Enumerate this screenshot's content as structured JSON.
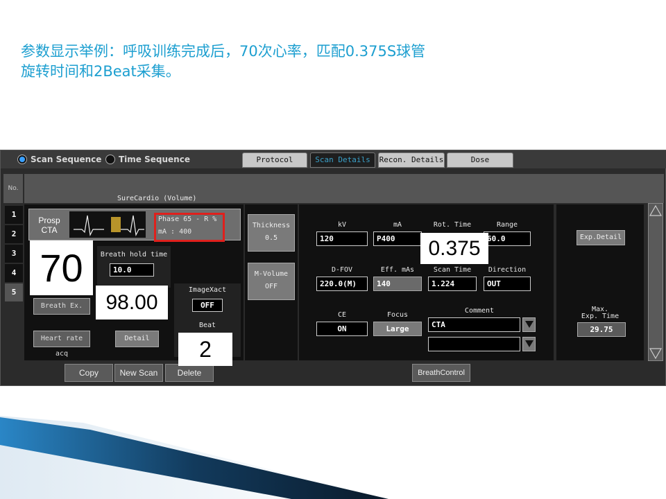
{
  "slide": {
    "title_line1": "参数显示举例：呼吸训练完成后，70次心率，匹配0.375S球管",
    "title_line2": "旋转时间和2Beat采集。"
  },
  "topbar": {
    "radio_scan_sequence": "Scan Sequence",
    "radio_time_sequence": "Time Sequence",
    "selected": "Scan Sequence",
    "tabs": [
      {
        "label": "Protocol"
      },
      {
        "label": "Scan Details"
      },
      {
        "label": "Recon. Details"
      },
      {
        "label": "Dose"
      }
    ],
    "active_tab": "Scan Details"
  },
  "sidebar": {
    "header": "No.",
    "rows": [
      "1",
      "2",
      "3",
      "4",
      "5"
    ],
    "selected_row": "5"
  },
  "plan": {
    "title": "SureCardio (Volume)",
    "mode_line1": "Prosp",
    "mode_line2": "CTA",
    "phase_text": "Phase 65 - R %",
    "ma_text": "mA : 400",
    "breath_hold_label": "Breath hold time",
    "breath_hold_value": "10.0",
    "breath_ex_button": "Breath Ex.",
    "heart_rate_button": "Heart rate acq",
    "detail_button": "Detail",
    "imagexact_label": "ImageXact",
    "imagexact_value": "OFF",
    "beat_label": "Beat",
    "thickness_label": "Thickness",
    "thickness_value": "0.5",
    "mvolume_label": "M-Volume",
    "mvolume_value": "OFF"
  },
  "params": {
    "kv_label": "kV",
    "kv_value": "120",
    "ma_label": "mA",
    "ma_value": "P400",
    "rot_time_label": "Rot. Time",
    "range_label": "Range",
    "range_value": "60.0",
    "dfov_label": "D-FOV",
    "dfov_value": "220.0(M)",
    "eff_mas_label": "Eff. mAs",
    "eff_mas_value": "140",
    "scan_time_label": "Scan Time",
    "scan_time_value": "1.224",
    "direction_label": "Direction",
    "direction_value": "OUT",
    "ce_label": "CE",
    "ce_value": "ON",
    "focus_label": "Focus",
    "focus_value": "Large",
    "comment_label": "Comment",
    "comment_value": "CTA",
    "comment_value2": ""
  },
  "right": {
    "exp_detail_button": "Exp.Detail",
    "max_exp_label1": "Max.",
    "max_exp_label2": "Exp. Time",
    "max_exp_value": "29.75"
  },
  "bottom": {
    "copy": "Copy",
    "new_scan": "New Scan",
    "delete": "Delete",
    "breath_control": "BreathControl"
  },
  "callouts": {
    "heart_rate": "70",
    "rot_time": "0.375",
    "breath_value": "98.00",
    "beat": "2"
  },
  "colors": {
    "title": "#1d9fd0",
    "highlight_border": "#e0201c",
    "active_tab_text": "#3aa0c8",
    "deco_dark": "#0a1a2a",
    "deco_blue": "#2a86c6"
  }
}
